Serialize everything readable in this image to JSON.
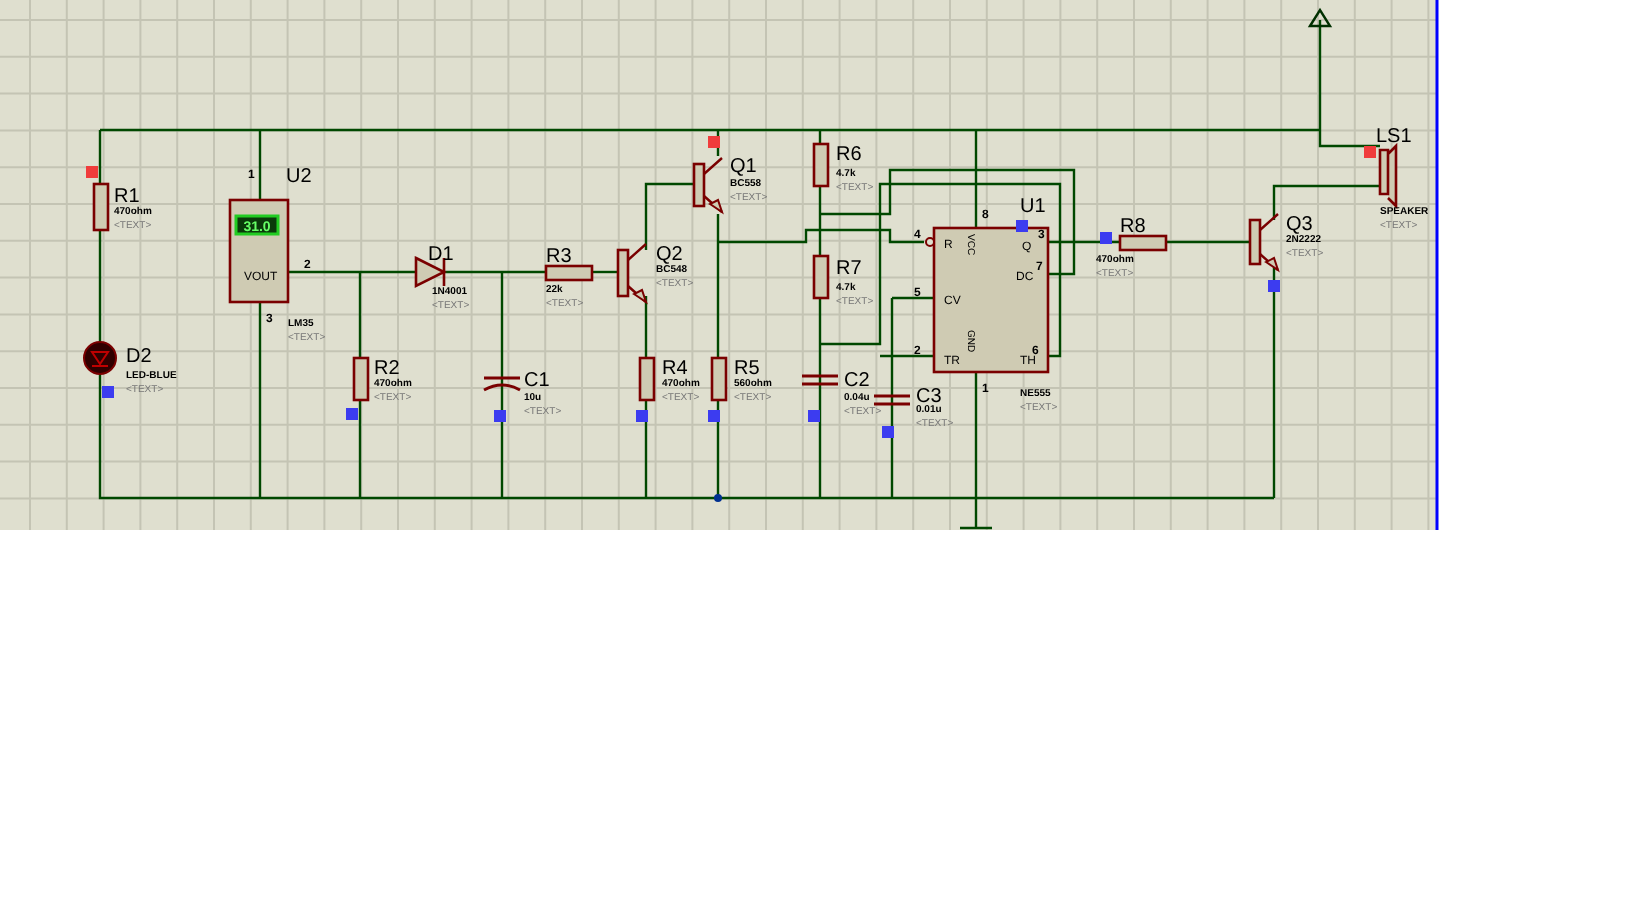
{
  "schematic": {
    "components": [
      {
        "kind": "resistor",
        "ref": "R1",
        "value": "470ohm",
        "text": "<TEXT>",
        "marker": {
          "color": "#f03c3c"
        }
      },
      {
        "kind": "led",
        "ref": "D2",
        "value": "LED-BLUE",
        "text": "<TEXT>",
        "marker": {
          "color": "#3c3cf0"
        }
      },
      {
        "kind": "sensor",
        "ref": "U2",
        "value": "LM35",
        "text": "<TEXT>",
        "display": "31.0",
        "pin_label": "VOUT",
        "pins": [
          "1",
          "2",
          "3"
        ]
      },
      {
        "kind": "diode",
        "ref": "D1",
        "value": "1N4001",
        "text": "<TEXT>"
      },
      {
        "kind": "resistor",
        "ref": "R2",
        "value": "470ohm",
        "text": "<TEXT>",
        "marker": {
          "color": "#3c3cf0"
        }
      },
      {
        "kind": "resistor",
        "ref": "R3",
        "value": "22k",
        "text": "<TEXT>"
      },
      {
        "kind": "capacitor",
        "ref": "C1",
        "value": "10u",
        "text": "<TEXT>",
        "marker": {
          "color": "#3c3cf0"
        }
      },
      {
        "kind": "transistor",
        "ref": "Q2",
        "value": "BC548",
        "text": "<TEXT>"
      },
      {
        "kind": "transistor",
        "ref": "Q1",
        "value": "BC558",
        "text": "<TEXT>",
        "marker": {
          "color": "#f03c3c"
        }
      },
      {
        "kind": "resistor",
        "ref": "R4",
        "value": "470ohm",
        "text": "<TEXT>",
        "marker": {
          "color": "#3c3cf0"
        }
      },
      {
        "kind": "resistor",
        "ref": "R5",
        "value": "560ohm",
        "text": "<TEXT>",
        "marker": {
          "color": "#3c3cf0"
        }
      },
      {
        "kind": "resistor",
        "ref": "R6",
        "value": "4.7k",
        "text": "<TEXT>"
      },
      {
        "kind": "resistor",
        "ref": "R7",
        "value": "4.7k",
        "text": "<TEXT>"
      },
      {
        "kind": "capacitor",
        "ref": "C2",
        "value": "0.04u",
        "text": "<TEXT>",
        "marker": {
          "color": "#3c3cf0"
        }
      },
      {
        "kind": "capacitor",
        "ref": "C3",
        "value": "0.01u",
        "text": "<TEXT>",
        "marker": {
          "color": "#3c3cf0"
        }
      },
      {
        "kind": "timer",
        "ref": "U1",
        "value": "NE555",
        "text": "<TEXT>",
        "marker": {
          "color": "#3c3cf0"
        },
        "pins": [
          {
            "number": "4",
            "label": "R"
          },
          {
            "number": "5",
            "label": "CV"
          },
          {
            "number": "2",
            "label": "TR"
          },
          {
            "number": "8",
            "label": "VCC"
          },
          {
            "number": "1",
            "label": "GND"
          },
          {
            "number": "3",
            "label": "Q"
          },
          {
            "number": "7",
            "label": "DC"
          },
          {
            "number": "6",
            "label": "TH"
          }
        ]
      },
      {
        "kind": "resistor",
        "ref": "R8",
        "value": "470ohm",
        "text": "<TEXT>",
        "marker": {
          "color": "#3c3cf0"
        }
      },
      {
        "kind": "transistor",
        "ref": "Q3",
        "value": "2N2222",
        "text": "<TEXT>",
        "marker": {
          "color": "#3c3cf0"
        }
      },
      {
        "kind": "speaker",
        "ref": "LS1",
        "value": "SPEAKER",
        "text": "<TEXT>",
        "marker": {
          "color": "#f03c3c"
        }
      }
    ]
  }
}
